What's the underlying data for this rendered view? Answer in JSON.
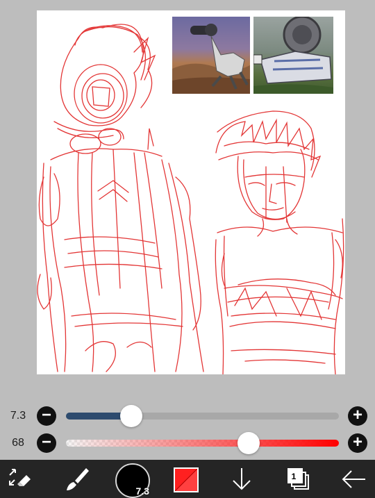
{
  "brush": {
    "size": "7.3",
    "size_fraction": 0.24
  },
  "opacity": {
    "value": "68",
    "fraction": 0.67
  },
  "colors": {
    "brush_color": "#ff2020",
    "size_track": "#2d4b6e",
    "toolbar_bg": "#252525",
    "sketch": "#e02020"
  },
  "layers": {
    "count": "1"
  },
  "icons": {
    "transform": "transform-eraser-icon",
    "brush": "brush-icon",
    "color": "color-swatch-icon",
    "download": "arrow-down-icon",
    "layers": "layers-icon",
    "back": "arrow-left-icon",
    "minus": "minus-icon",
    "plus": "plus-icon"
  }
}
